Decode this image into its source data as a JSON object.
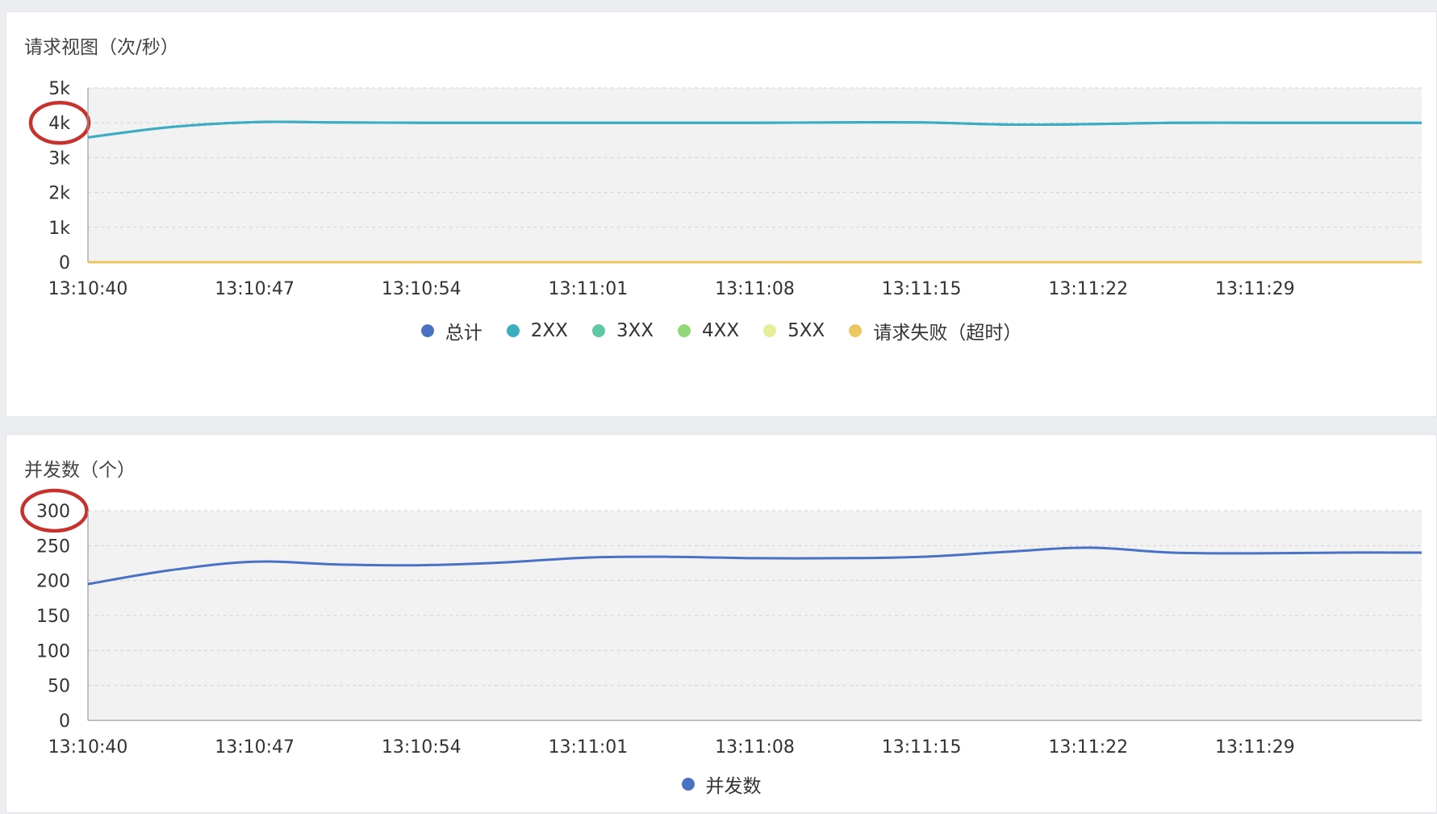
{
  "chart_data": [
    {
      "type": "line",
      "title": "请求视图（次/秒）",
      "x": [
        "13:10:40",
        "13:10:43.5",
        "13:10:47",
        "13:10:50.5",
        "13:10:54",
        "13:10:57.5",
        "13:11:01",
        "13:11:04.5",
        "13:11:08",
        "13:11:11.5",
        "13:11:15",
        "13:11:18.5",
        "13:11:22",
        "13:11:25.5",
        "13:11:29",
        "13:11:32.5",
        "13:11:36"
      ],
      "x_ticks": [
        "13:10:40",
        "13:10:47",
        "13:10:54",
        "13:11:01",
        "13:11:08",
        "13:11:15",
        "13:11:22",
        "13:11:29"
      ],
      "y_ticks": [
        "0",
        "1k",
        "2k",
        "3k",
        "4k",
        "5k"
      ],
      "ylim": [
        0,
        5000
      ],
      "grid": true,
      "legend_position": "bottom",
      "series": [
        {
          "name": "总计",
          "color": "#4a72c4",
          "values": [
            3580,
            3880,
            4020,
            4010,
            4000,
            4000,
            4000,
            4000,
            4000,
            4010,
            4010,
            3950,
            3960,
            4000,
            4000,
            4000,
            4000
          ]
        },
        {
          "name": "2XX",
          "color": "#3bafc1",
          "values": [
            3580,
            3880,
            4020,
            4010,
            4000,
            4000,
            4000,
            4000,
            4000,
            4010,
            4010,
            3950,
            3960,
            4000,
            4000,
            4000,
            4000
          ]
        },
        {
          "name": "3XX",
          "color": "#5ec8a2",
          "values": [
            0,
            0,
            0,
            0,
            0,
            0,
            0,
            0,
            0,
            0,
            0,
            0,
            0,
            0,
            0,
            0,
            0
          ]
        },
        {
          "name": "4XX",
          "color": "#93d77a",
          "values": [
            0,
            0,
            0,
            0,
            0,
            0,
            0,
            0,
            0,
            0,
            0,
            0,
            0,
            0,
            0,
            0,
            0
          ]
        },
        {
          "name": "5XX",
          "color": "#e6ee9c",
          "values": [
            0,
            0,
            0,
            0,
            0,
            0,
            0,
            0,
            0,
            0,
            0,
            0,
            0,
            0,
            0,
            0,
            0
          ]
        },
        {
          "name": "请求失败（超时）",
          "color": "#ecc760",
          "values": [
            0,
            0,
            0,
            0,
            0,
            0,
            0,
            0,
            0,
            0,
            0,
            0,
            0,
            0,
            0,
            0,
            0
          ]
        }
      ],
      "highlighted_tick": "4k"
    },
    {
      "type": "line",
      "title": "并发数（个）",
      "x": [
        "13:10:40",
        "13:10:43.5",
        "13:10:47",
        "13:10:50.5",
        "13:10:54",
        "13:10:57.5",
        "13:11:01",
        "13:11:04.5",
        "13:11:08",
        "13:11:11.5",
        "13:11:15",
        "13:11:18.5",
        "13:11:22",
        "13:11:25.5",
        "13:11:29",
        "13:11:32.5",
        "13:11:36"
      ],
      "x_ticks": [
        "13:10:40",
        "13:10:47",
        "13:10:54",
        "13:11:01",
        "13:11:08",
        "13:11:15",
        "13:11:22",
        "13:11:29"
      ],
      "y_ticks": [
        "0",
        "50",
        "100",
        "150",
        "200",
        "250",
        "300"
      ],
      "ylim": [
        0,
        300
      ],
      "grid": true,
      "legend_position": "bottom",
      "series": [
        {
          "name": "并发数",
          "color": "#4a72c4",
          "values": [
            195,
            215,
            227,
            223,
            222,
            226,
            233,
            234,
            232,
            232,
            234,
            241,
            247,
            240,
            239,
            240,
            240
          ]
        }
      ],
      "highlighted_tick": "300"
    }
  ],
  "highlight_color": "#c8322d"
}
